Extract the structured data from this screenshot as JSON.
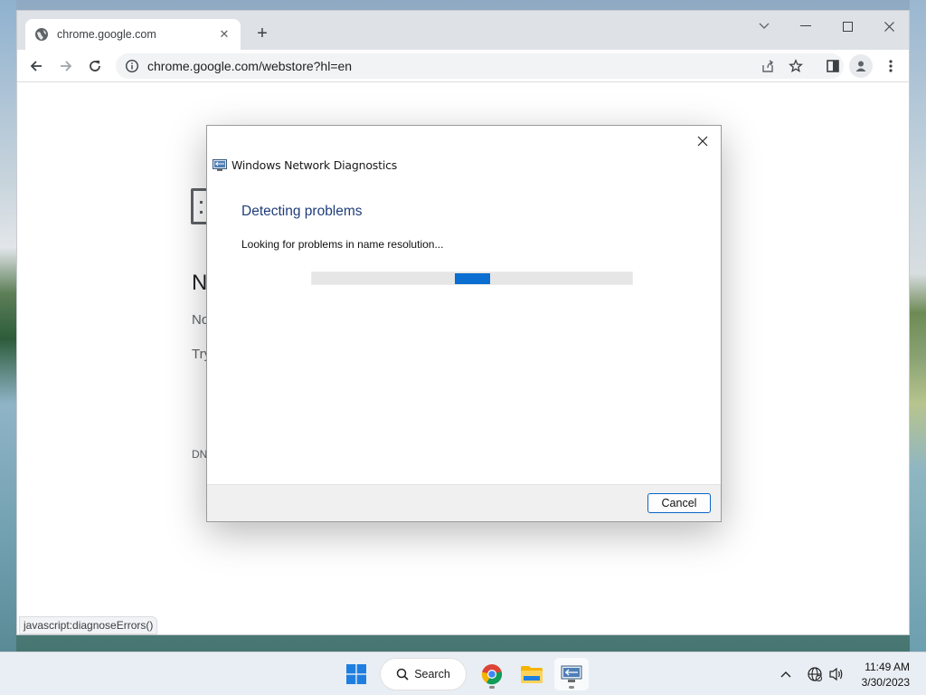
{
  "browser": {
    "tab": {
      "title": "chrome.google.com",
      "favicon": "globe-icon"
    },
    "new_tab_label": "+",
    "address_bar": {
      "url": "chrome.google.com/webstore?hl=en"
    },
    "status_url": "javascript:diagnoseErrors()"
  },
  "page_peek": {
    "heading": "N",
    "line1": "No",
    "line2": "Try",
    "footer_code": "DN"
  },
  "dialog": {
    "app_title": "Windows Network Diagnostics",
    "heading": "Detecting problems",
    "status": "Looking for problems in name resolution...",
    "progress_indeterminate": true,
    "cancel_label": "Cancel"
  },
  "taskbar": {
    "search_label": "Search",
    "time": "11:49 AM",
    "date": "3/30/2023"
  },
  "colors": {
    "accent": "#0a6fd0",
    "dialog_heading": "#1f3d7a",
    "chrome_frame": "#dee1e6"
  }
}
